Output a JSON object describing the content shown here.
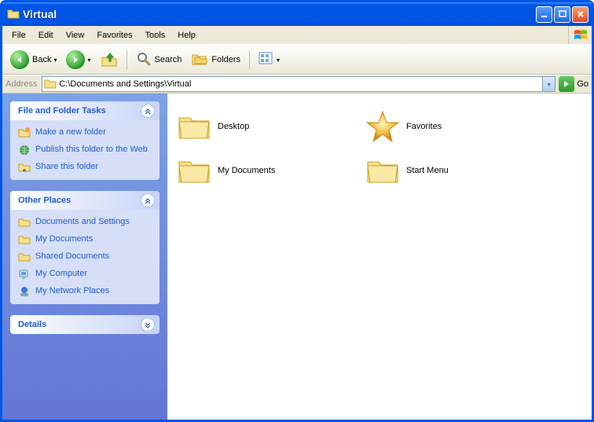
{
  "window": {
    "title": "Virtual"
  },
  "menu": {
    "file": "File",
    "edit": "Edit",
    "view": "View",
    "favorites": "Favorites",
    "tools": "Tools",
    "help": "Help"
  },
  "toolbar": {
    "back": "Back",
    "search": "Search",
    "folders": "Folders"
  },
  "addressbar": {
    "label": "Address",
    "path": "C:\\Documents and Settings\\Virtual",
    "go": "Go"
  },
  "sidebar": {
    "tasks": {
      "title": "File and Folder Tasks",
      "items": [
        {
          "label": "Make a new folder"
        },
        {
          "label": "Publish this folder to the Web"
        },
        {
          "label": "Share this folder"
        }
      ]
    },
    "other": {
      "title": "Other Places",
      "items": [
        {
          "label": "Documents and Settings"
        },
        {
          "label": "My Documents"
        },
        {
          "label": "Shared Documents"
        },
        {
          "label": "My Computer"
        },
        {
          "label": "My Network Places"
        }
      ]
    },
    "details": {
      "title": "Details"
    }
  },
  "files": [
    {
      "label": "Desktop",
      "type": "folder"
    },
    {
      "label": "Favorites",
      "type": "star"
    },
    {
      "label": "My Documents",
      "type": "folder"
    },
    {
      "label": "Start Menu",
      "type": "folder"
    }
  ]
}
